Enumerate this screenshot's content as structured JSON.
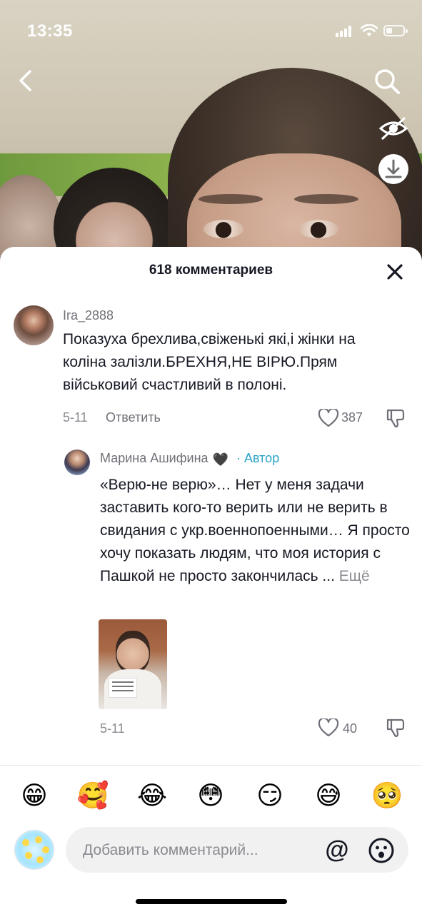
{
  "status_bar": {
    "time": "13:35"
  },
  "overlay": {
    "back_icon": "chevron-left-icon",
    "search_icon": "search-icon",
    "hide_icon": "eye-off-icon",
    "download_icon": "download-icon"
  },
  "comments_sheet": {
    "title": "618 комментариев",
    "comments": [
      {
        "username": "Ira_2888",
        "text": "Показуха брехлива,свіженькі які,і жінки на коліна залізли.БРЕХНЯ,НЕ ВІРЮ.Прям військовий счастливий в полоні.",
        "date": "5-11",
        "reply_label": "Ответить",
        "likes": "387"
      },
      {
        "username": "Марина Ашифина",
        "badge": "🖤",
        "author_label": "Автор",
        "text": "«Верю-не верю»… Нет у меня задачи заставить кого-то верить или не верить в свидания с укр.военнопоенными… Я просто хочу показать людям, что моя история с Пашкой не просто закончилась ...",
        "more_label": "Ещё",
        "date": "5-11",
        "likes": "40"
      }
    ]
  },
  "emoji_bar": [
    "😁",
    "🥰",
    "😂",
    "😳",
    "😏",
    "😅",
    "🥺"
  ],
  "comment_input": {
    "placeholder": "Добавить комментарий...",
    "mention_label": "@"
  },
  "colors": {
    "author": "#2aa4c7",
    "text": "#161823",
    "secondary": "#8a8b91"
  }
}
